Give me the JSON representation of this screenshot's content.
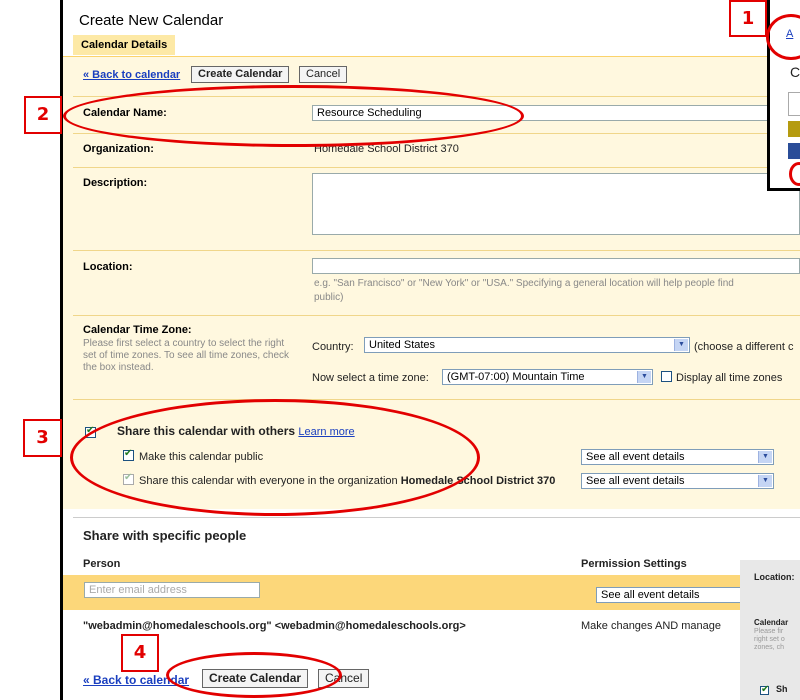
{
  "header": {
    "title": "Create New Calendar",
    "tab": "Calendar Details"
  },
  "toolbar_top": {
    "back_link": "« Back to calendar",
    "create_label": "Create Calendar",
    "cancel_label": "Cancel"
  },
  "fields": {
    "name_label": "Calendar Name:",
    "name_value": "Resource Scheduling",
    "org_label": "Organization:",
    "org_value": "Homedale School District 370",
    "desc_label": "Description:",
    "location_label": "Location:",
    "location_hint_1": "e.g. \"San Francisco\" or \"New York\" or \"USA.\" Specifying a general location will help people find",
    "location_hint_2": "public)",
    "tz_label": "Calendar Time Zone:",
    "tz_help": "Please first select a country to select the right set of time zones. To see all time zones, check the box instead.",
    "country_label": "Country:",
    "country_value": "United States",
    "country_alt": "(choose a different c",
    "tz_select_label": "Now select a time zone:",
    "tz_value": "(GMT-07:00) Mountain Time",
    "tz_all": "Display all time zones"
  },
  "sharing": {
    "title": "Share this calendar with others",
    "learn_more": "Learn more",
    "public_label": "Make this calendar public",
    "public_perm": "See all event details",
    "org_label": "Share this calendar with everyone in the organization",
    "org_name": "Homedale School District 370",
    "org_perm": "See all event details"
  },
  "specific": {
    "title": "Share with specific people",
    "col_person": "Person",
    "col_perm": "Permission Settings",
    "email_placeholder": "Enter email address",
    "add_perm": "See all event details",
    "row_person": "\"webadmin@homedaleschools.org\" <webadmin@homedaleschools.org>",
    "row_perm": "Make changes AND manage"
  },
  "toolbar_bottom": {
    "back_link": "« Back to calendar",
    "create_label": "Create Calendar",
    "cancel_label": "Cancel"
  },
  "annotations": [
    "1",
    "2",
    "3",
    "4"
  ],
  "side_fragments": {
    "top_letter_a": "A",
    "top_letter_c": "C",
    "bottom_location": "Location:",
    "bottom_calendar": "Calendar",
    "bottom_help": "Please fir right set o zones, ch",
    "bottom_share": "Sh"
  }
}
